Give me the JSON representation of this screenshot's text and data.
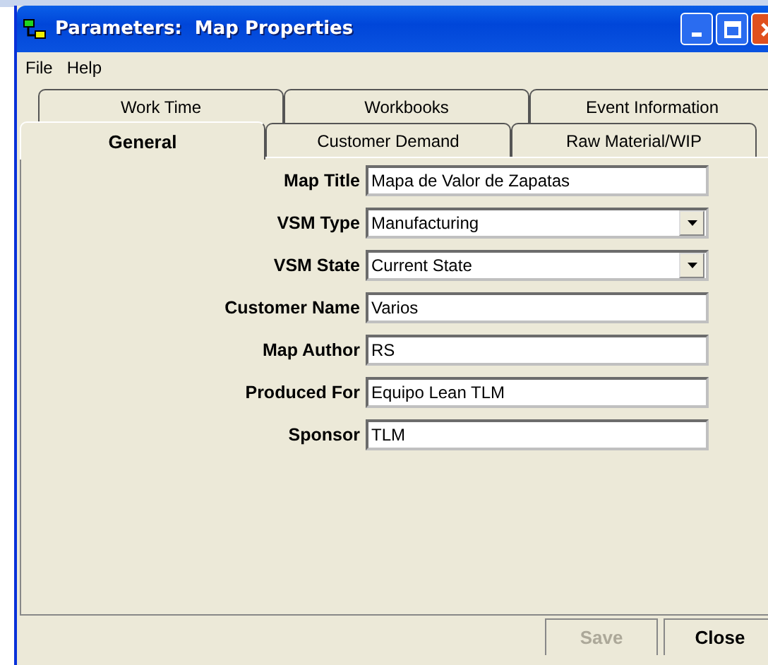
{
  "window": {
    "title": "Parameters:  Map Properties"
  },
  "menu": [
    "File",
    "Help"
  ],
  "tab_rows": [
    [
      {
        "label": "Work Time",
        "selected": false
      },
      {
        "label": "Workbooks",
        "selected": false
      },
      {
        "label": "Event Information",
        "selected": false
      }
    ],
    [
      {
        "label": "General",
        "selected": true
      },
      {
        "label": "Customer Demand",
        "selected": false
      },
      {
        "label": "Raw Material/WIP",
        "selected": false
      }
    ]
  ],
  "fields": [
    {
      "label": "Map Title",
      "kind": "text",
      "value": "Mapa de Valor de Zapatas"
    },
    {
      "label": "VSM Type",
      "kind": "dropdown",
      "value": "Manufacturing"
    },
    {
      "label": "VSM State",
      "kind": "dropdown",
      "value": "Current State"
    },
    {
      "label": "Customer Name",
      "kind": "text",
      "value": "Varios"
    },
    {
      "label": "Map Author",
      "kind": "text",
      "value": "RS"
    },
    {
      "label": "Produced For",
      "kind": "text",
      "value": "Equipo Lean TLM"
    },
    {
      "label": "Sponsor",
      "kind": "text",
      "value": "TLM"
    }
  ],
  "buttons": [
    {
      "label": "Save",
      "disabled": true
    },
    {
      "label": "Close",
      "disabled": false
    }
  ]
}
